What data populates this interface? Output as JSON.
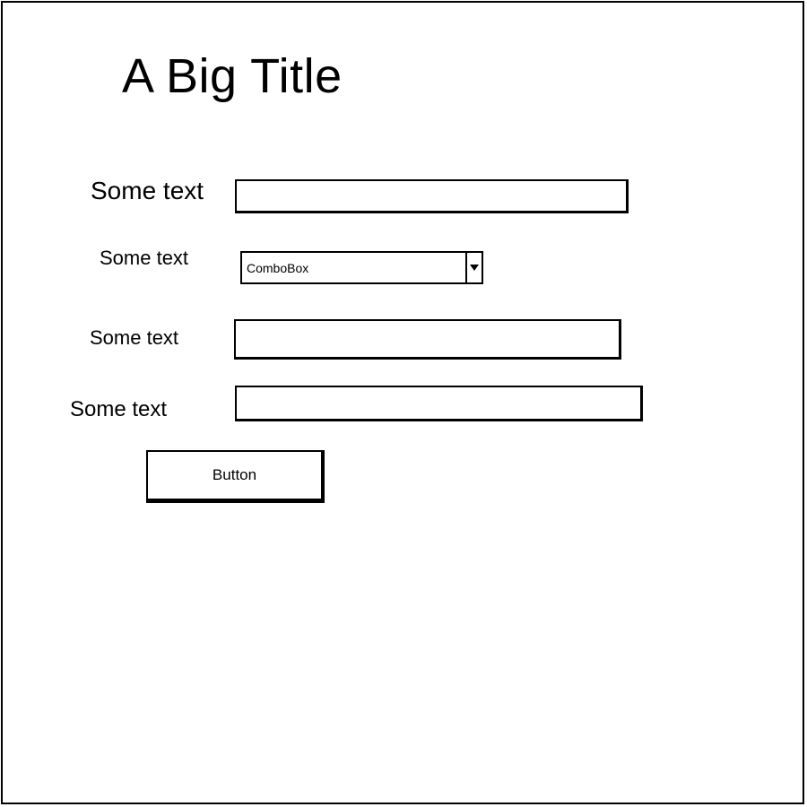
{
  "page": {
    "title": "A Big Title"
  },
  "form": {
    "rows": [
      {
        "label": "Some text",
        "value": "",
        "placeholder": ""
      },
      {
        "label": "Some text",
        "combo_value": "ComboBox"
      },
      {
        "label": "Some text",
        "value": "",
        "placeholder": ""
      },
      {
        "label": "Some text",
        "value": "",
        "placeholder": ""
      }
    ],
    "button_label": "Button"
  },
  "icons": {
    "combo_toggle": "chevron-down-icon"
  }
}
